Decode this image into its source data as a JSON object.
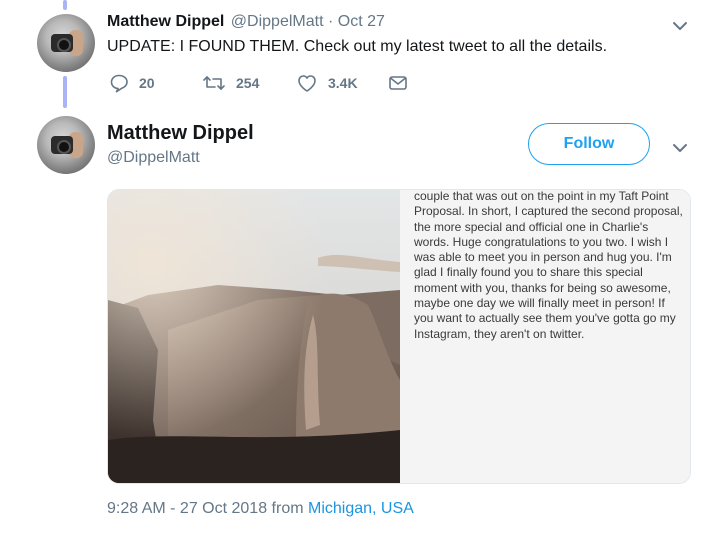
{
  "reply_tweet": {
    "author_name": "Matthew Dippel",
    "author_handle": "@DippelMatt",
    "separator": "·",
    "date": "Oct 27",
    "text": "UPDATE: I FOUND THEM. Check out my latest tweet to all the details.",
    "actions": {
      "replies": "20",
      "retweets": "254",
      "likes": "3.4K"
    }
  },
  "main_tweet": {
    "author_name": "Matthew Dippel",
    "author_handle": "@DippelMatt",
    "follow_label": "Follow",
    "notes_text": "couple that was out on the point in my Taft Point Proposal. In short, I captured the second proposal, the more special and official one in Charlie's words. Huge congratulations  to you two. I wish I was able to meet you in person and hug you. I'm glad I finally found you to share this special moment with you, thanks for being so awesome, maybe one day we will finally meet in person! If you want to actually see them you've gotta go my Instagram, they aren't on twitter.",
    "timestamp_prefix": "9:28 AM - 27 Oct 2018 from ",
    "location": "Michigan, USA"
  },
  "icons": [
    "reply-icon",
    "retweet-icon",
    "like-icon",
    "message-icon",
    "chevron-down-icon"
  ],
  "colors": {
    "accent": "#1da1f2",
    "location_link": "#1b95e0",
    "thread_line": "#a9b3f5",
    "muted": "#657786"
  }
}
